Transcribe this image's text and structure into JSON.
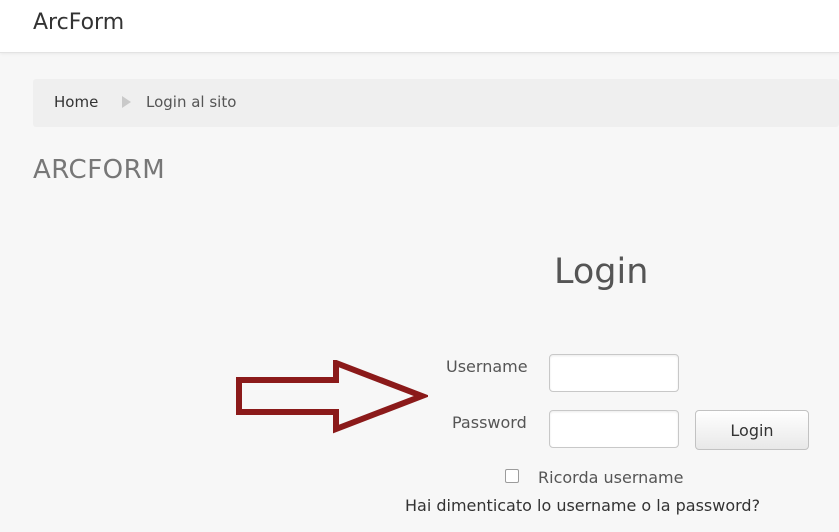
{
  "navbar": {
    "brand": "ArcForm"
  },
  "breadcrumb": {
    "items": [
      {
        "label": "Home"
      },
      {
        "label": "Login al sito"
      }
    ]
  },
  "page": {
    "heading": "ARCFORM"
  },
  "login_form": {
    "title": "Login",
    "username_label": "Username",
    "username_value": "",
    "password_label": "Password",
    "password_value": "",
    "submit_label": "Login",
    "remember_label": "Ricorda username",
    "remember_checked": false,
    "forgot_link": "Hai dimenticato lo username o la password?"
  },
  "annotation": {
    "arrow_icon": "right-arrow-icon",
    "arrow_color": "#8b1a1a"
  }
}
